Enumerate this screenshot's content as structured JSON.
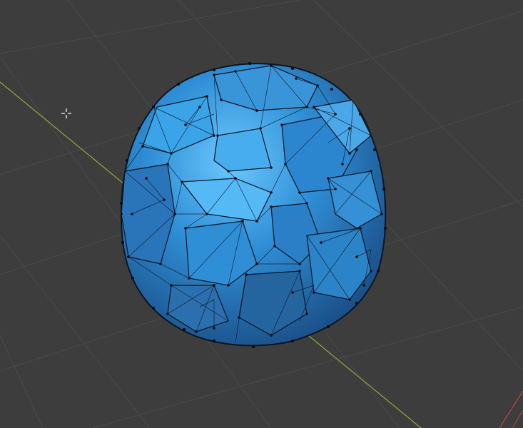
{
  "viewport": {
    "background": "#3d3d3d",
    "grid_color": "#4a4a4a",
    "x_axis_color": "#8ca33a",
    "mesh": {
      "type": "sphere",
      "mode": "wireframe-over-shaded",
      "base_color": "#2f8fd6",
      "highlight_color": "#5fc0ff",
      "shadow_color": "#1c4f86",
      "edge_color": "#0b1624",
      "vertex_color": "#050a10"
    },
    "cursor_icon": "3d-cursor-crosshair-icon"
  }
}
